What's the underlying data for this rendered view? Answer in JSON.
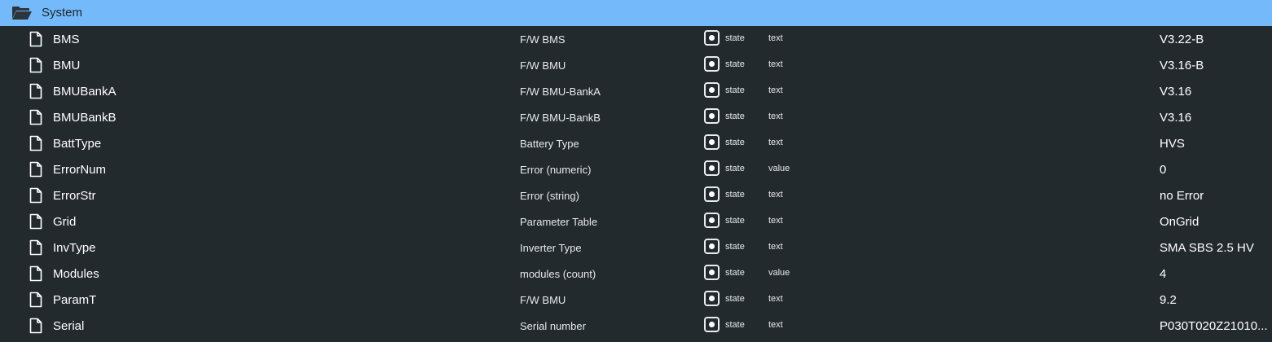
{
  "folder": {
    "title": "System",
    "icon": "folder-open-icon"
  },
  "rows": [
    {
      "name": "BMS",
      "desc": "F/W BMS",
      "role": "state",
      "type": "text",
      "value": "V3.22-B"
    },
    {
      "name": "BMU",
      "desc": "F/W BMU",
      "role": "state",
      "type": "text",
      "value": "V3.16-B"
    },
    {
      "name": "BMUBankA",
      "desc": "F/W BMU-BankA",
      "role": "state",
      "type": "text",
      "value": "V3.16"
    },
    {
      "name": "BMUBankB",
      "desc": "F/W BMU-BankB",
      "role": "state",
      "type": "text",
      "value": "V3.16"
    },
    {
      "name": "BattType",
      "desc": "Battery Type",
      "role": "state",
      "type": "text",
      "value": "HVS"
    },
    {
      "name": "ErrorNum",
      "desc": "Error (numeric)",
      "role": "state",
      "type": "value",
      "value": "0"
    },
    {
      "name": "ErrorStr",
      "desc": "Error (string)",
      "role": "state",
      "type": "text",
      "value": "no Error"
    },
    {
      "name": "Grid",
      "desc": "Parameter Table",
      "role": "state",
      "type": "text",
      "value": "OnGrid"
    },
    {
      "name": "InvType",
      "desc": "Inverter Type",
      "role": "state",
      "type": "text",
      "value": "SMA SBS 2.5 HV"
    },
    {
      "name": "Modules",
      "desc": "modules (count)",
      "role": "state",
      "type": "value",
      "value": "4"
    },
    {
      "name": "ParamT",
      "desc": "F/W BMU",
      "role": "state",
      "type": "text",
      "value": "9.2"
    },
    {
      "name": "Serial",
      "desc": "Serial number",
      "role": "state",
      "type": "text",
      "value": "P030T020Z21010..."
    }
  ],
  "colors": {
    "header_bg": "#74b9f9",
    "body_bg": "#232a2e",
    "text": "#ffffff"
  }
}
